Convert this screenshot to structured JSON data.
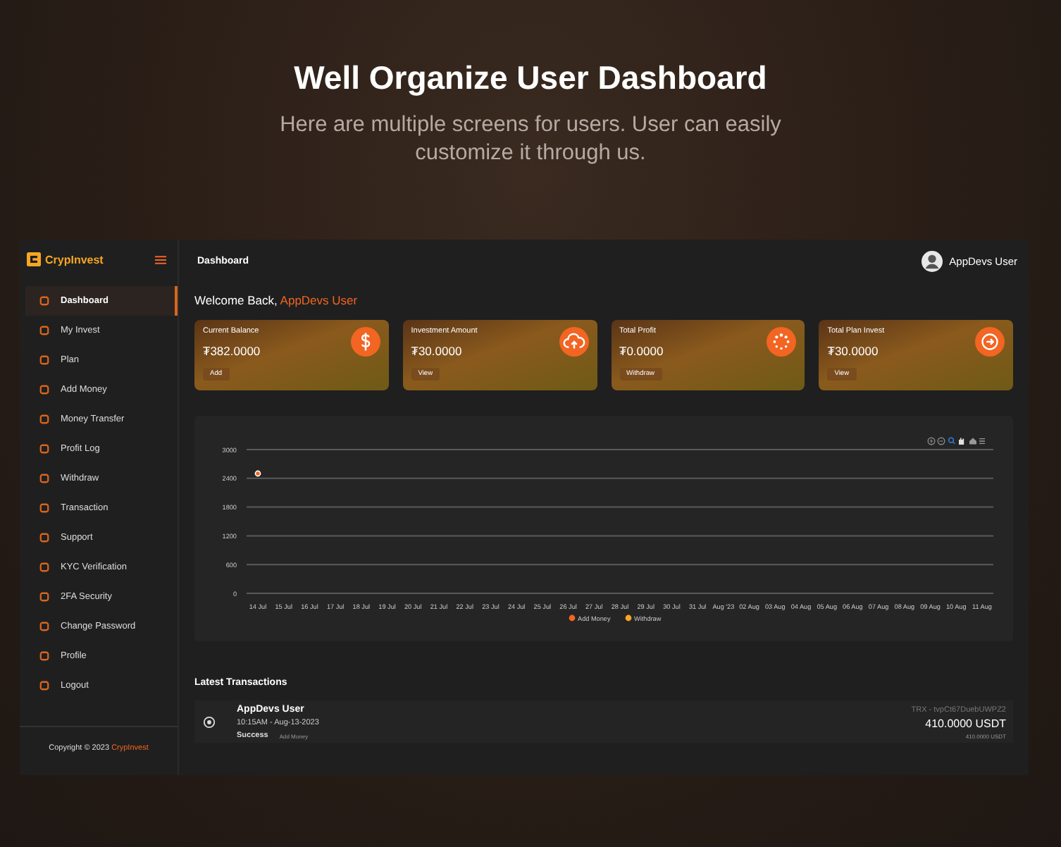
{
  "heading": {
    "title": "Well Organize User Dashboard",
    "subtitle": "Here are multiple screens for users. User can easily customize it through us."
  },
  "brand": {
    "name": "CrypInvest"
  },
  "sidebar": {
    "items": [
      {
        "label": "Dashboard",
        "selected": true
      },
      {
        "label": "My Invest",
        "selected": false
      },
      {
        "label": "Plan",
        "selected": false
      },
      {
        "label": "Add Money",
        "selected": false
      },
      {
        "label": "Money Transfer",
        "selected": false
      },
      {
        "label": "Profit Log",
        "selected": false
      },
      {
        "label": "Withdraw",
        "selected": false
      },
      {
        "label": "Transaction",
        "selected": false
      },
      {
        "label": "Support",
        "selected": false
      },
      {
        "label": "KYC Verification",
        "selected": false
      },
      {
        "label": "2FA Security",
        "selected": false
      },
      {
        "label": "Change Password",
        "selected": false
      },
      {
        "label": "Profile",
        "selected": false
      },
      {
        "label": "Logout",
        "selected": false
      }
    ],
    "copyright": {
      "text": "Copyright © 2023",
      "brand": "CrypInvest"
    }
  },
  "header": {
    "title": "Dashboard",
    "user": "AppDevs User"
  },
  "welcome": {
    "text": "Welcome Back,",
    "name": "AppDevs User"
  },
  "cards": [
    {
      "label": "Current Balance",
      "amount": "₮382.0000",
      "action": "Add",
      "kind": "dollar"
    },
    {
      "label": "Investment Amount",
      "amount": "₮30.0000",
      "action": "View",
      "kind": "upload"
    },
    {
      "label": "Total Profit",
      "amount": "₮0.0000",
      "action": "Withdraw",
      "kind": "spinner"
    },
    {
      "label": "Total Plan Invest",
      "amount": "₮30.0000",
      "action": "View",
      "kind": "arrow"
    }
  ],
  "chart": {
    "chart_data": {
      "type": "line",
      "categories": [
        "14 Jul",
        "15 Jul",
        "16 Jul",
        "17 Jul",
        "18 Jul",
        "19 Jul",
        "20 Jul",
        "21 Jul",
        "22 Jul",
        "23 Jul",
        "24 Jul",
        "25 Jul",
        "26 Jul",
        "27 Jul",
        "28 Jul",
        "29 Jul",
        "30 Jul",
        "31 Jul",
        "Aug '23",
        "02 Aug",
        "03 Aug",
        "04 Aug",
        "05 Aug",
        "06 Aug",
        "07 Aug",
        "08 Aug",
        "09 Aug",
        "10 Aug",
        "11 Aug"
      ],
      "series": [
        {
          "name": "Add Money",
          "color": "#f26522",
          "marker": true,
          "values": [
            2500,
            null,
            null,
            null,
            null,
            null,
            null,
            null,
            null,
            null,
            null,
            null,
            null,
            null,
            null,
            null,
            null,
            null,
            null,
            null,
            null,
            null,
            null,
            null,
            null,
            null,
            null,
            null,
            null
          ]
        },
        {
          "name": "Withdraw",
          "color": "#f5a623",
          "values": [
            null,
            null,
            null,
            null,
            null,
            null,
            null,
            null,
            null,
            null,
            null,
            null,
            null,
            null,
            null,
            null,
            null,
            null,
            null,
            null,
            null,
            null,
            null,
            null,
            null,
            null,
            null,
            null,
            null
          ]
        }
      ],
      "grid": true,
      "ylim": [
        0,
        3000
      ],
      "yticks": [
        0,
        600,
        1200,
        1800,
        2400,
        3000
      ]
    }
  },
  "transactions": {
    "title": "Latest Transactions",
    "rows": [
      {
        "name": "AppDevs User",
        "time": "10:15AM - Aug-13-2023",
        "status": "Success",
        "type": "Add Money",
        "trx": "TRX - tvpCt67DuebUWPZ2",
        "amount": "410.0000 USDT",
        "sub_amount": "410.0000 USDT"
      }
    ]
  }
}
